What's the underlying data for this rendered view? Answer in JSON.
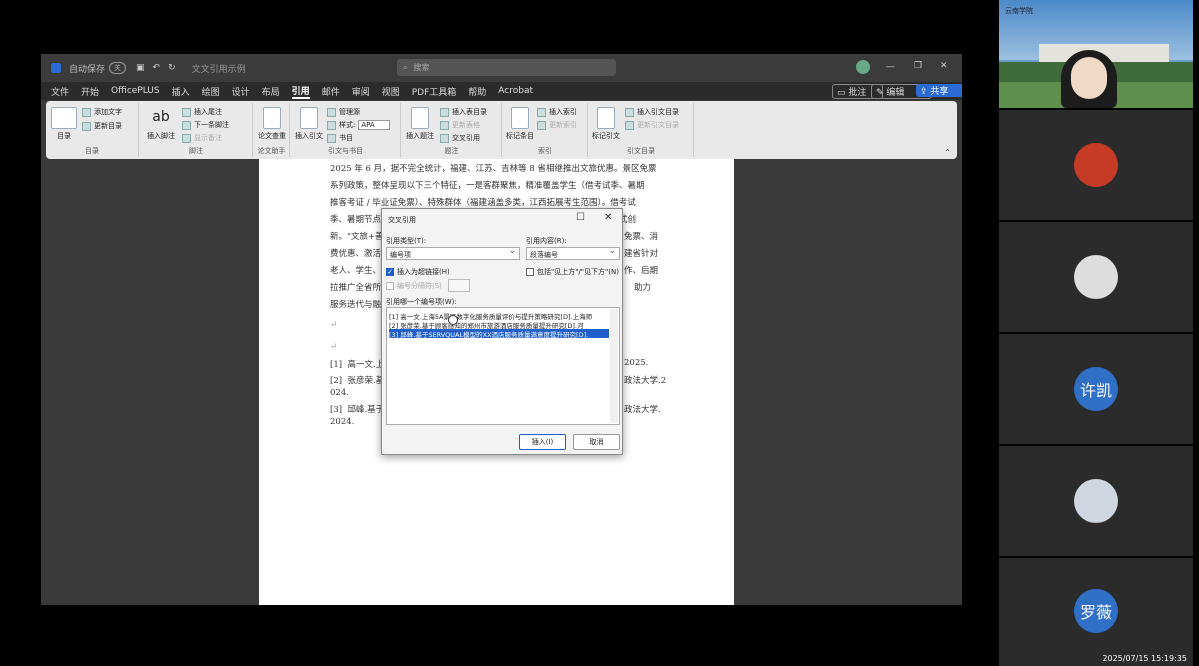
{
  "meeting": {
    "timestamp": "2025/07/15 15:19:35",
    "participants": [
      {
        "name": "",
        "initials": ""
      },
      {
        "name": "",
        "initials": ""
      },
      {
        "name": "",
        "initials": ""
      },
      {
        "name": "许凯",
        "initials": "许凯",
        "color": "#2f6fc6"
      },
      {
        "name": "",
        "initials": ""
      },
      {
        "name": "罗薇",
        "initials": "罗薇",
        "color": "#2f6fc6"
      }
    ],
    "video_tile_logo": "云南学院"
  },
  "word": {
    "autosave_label": "自动保存",
    "autosave_state": "关",
    "doc_name": "文文引用示例",
    "search_placeholder": "搜索",
    "tabs": [
      "文件",
      "开始",
      "OfficePLUS",
      "插入",
      "绘图",
      "设计",
      "布局",
      "引用",
      "邮件",
      "审阅",
      "视图",
      "PDF工具箱",
      "帮助",
      "Acrobat"
    ],
    "active_tab": "引用",
    "right_buttons": {
      "comment": "批注",
      "edit": "编辑",
      "share": "共享"
    },
    "ribbon": {
      "toc": "目录",
      "add_text": "添加文字",
      "update_toc": "更新目录",
      "group_toc": "目录",
      "insert_footnote": "插入脚注",
      "insert_endnote": "插入尾注",
      "next_footnote": "下一条脚注",
      "show_notes": "显示备注",
      "group_footnote": "脚注",
      "paper_search": "论文查重",
      "group_paper": "论文助手",
      "insert_citation": "插入引文",
      "manage_sources": "管理源",
      "style_label": "样式:",
      "style_value": "APA",
      "bibliography": "书目",
      "group_citation": "引文与书目",
      "insert_caption": "插入题注",
      "insert_table_of_figures": "插入表目录",
      "update_table": "更新表格",
      "cross_reference": "交叉引用",
      "group_caption": "题注",
      "mark_entry": "标记条目",
      "insert_index": "插入索引",
      "update_index": "更新索引",
      "group_index": "索引",
      "mark_citation": "标记引文",
      "insert_toa": "插入引文目录",
      "update_toa": "更新引文目录",
      "group_toa": "引文目录"
    },
    "document": {
      "lines": [
        "2025 年 6 月，据不完全统计，福建、江苏、吉林等 8 省相继推出文旅优惠。景区免票",
        "系列政策，整体呈现以下三个特征，一是客群聚焦，精准覆盖学生（借考试季、暑期",
        "推客考证 / 毕业证免票）、特殊群体（福建涵盖多类，江西拓展考生范围）。借考试",
        "季、暑期节点，毕业学生直既、契合其旅游需求，吸引年轻消费群体，二是模式创",
        "新。\"文旅+善",
        "费优惠、激活",
        "老人、学生、",
        "拉推广全省所",
        "服务迭代与融"
      ],
      "right_fragments": [
        "免票、消",
        "建省针对",
        "作、后期",
        "助力"
      ],
      "refs": [
        {
          "num": "[1]",
          "text": "高一文.上",
          "tail": "2025."
        },
        {
          "num": "[2]",
          "text": "张彦荣.基",
          "tail": "政法大学.2"
        },
        {
          "num": "",
          "text": "024.",
          "tail": ""
        },
        {
          "num": "[3]",
          "text": "邱峰.基于",
          "tail": "政法大学."
        },
        {
          "num": "",
          "text": "2024.",
          "tail": ""
        }
      ]
    },
    "dialog": {
      "title": "交叉引用",
      "ref_type_label": "引用类型(T):",
      "ref_type_value": "编号项",
      "ref_content_label": "引用内容(R):",
      "ref_content_value": "段落编号",
      "insert_hyperlink": "插入为超链接(H)",
      "include_above_below": "包括\"见上方\"/\"见下方\"(N)",
      "separate_numbers": "编号分隔符(S)",
      "which_item_label": "引用哪一个编号项(W):",
      "items": [
        "[1] 高一文.上海5A景区数字化服务质量评价与提升策略研究[D].上海师",
        "[2] 张彦荣.基于顾客感知的郑州市旅游酒店服务质量提升研究[D].河",
        "[3] 邱峰.基于SERVQUAL模型的XX酒店服务质量满意度提升研究[D]."
      ],
      "selected_index": 2,
      "insert_button": "插入(I)",
      "cancel_button": "取消"
    }
  }
}
